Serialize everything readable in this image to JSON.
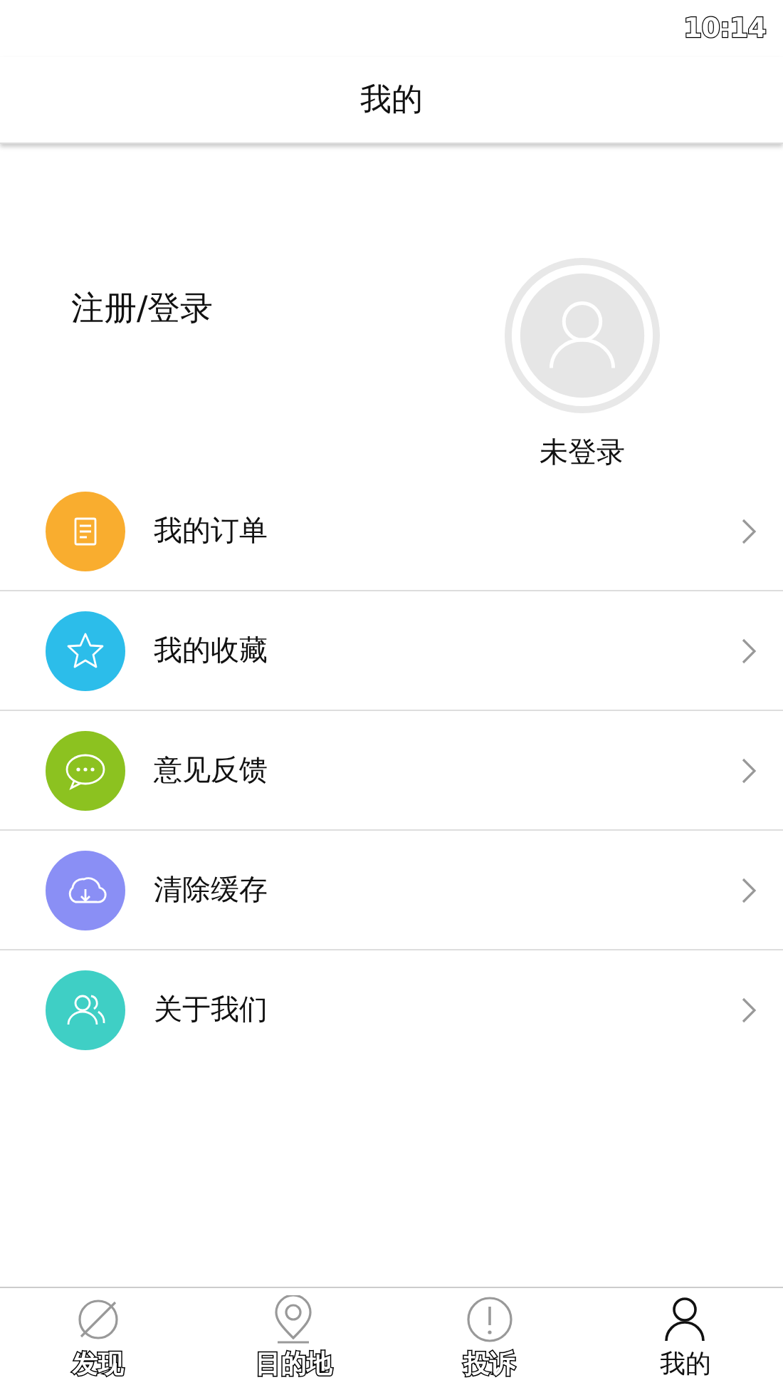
{
  "status_bar": {
    "time": "10:14"
  },
  "header": {
    "title": "我的"
  },
  "profile": {
    "login_link": "注册/登录",
    "status": "未登录"
  },
  "menu": [
    {
      "label": "我的订单",
      "color": "#f9ad2f"
    },
    {
      "label": "我的收藏",
      "color": "#2cbdea"
    },
    {
      "label": "意见反馈",
      "color": "#8cc220"
    },
    {
      "label": "清除缓存",
      "color": "#8a8ff5"
    },
    {
      "label": "关于我们",
      "color": "#3fcfc5"
    }
  ],
  "tabs": [
    {
      "label": "发现",
      "selected": false
    },
    {
      "label": "目的地",
      "selected": false
    },
    {
      "label": "投诉",
      "selected": false
    },
    {
      "label": "我的",
      "selected": true
    }
  ]
}
